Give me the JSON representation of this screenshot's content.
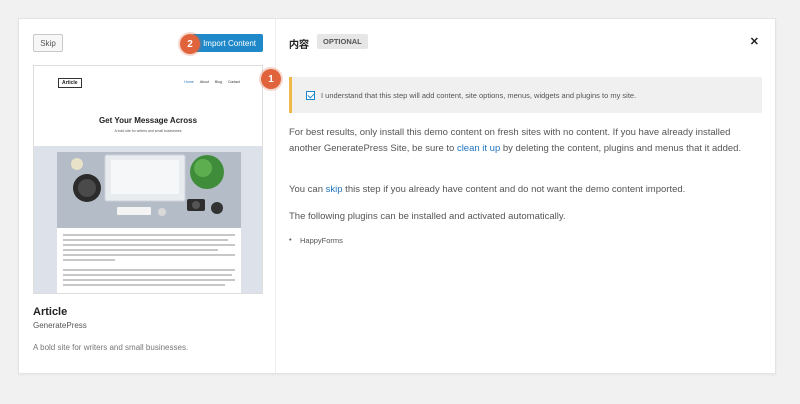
{
  "left": {
    "skip_label": "Skip",
    "import_label": "Import Content",
    "badge_two": "2",
    "preview": {
      "logo": "Article",
      "nav": [
        "Home",
        "About",
        "Blog",
        "Contact"
      ],
      "hero_title": "Get Your Message Across",
      "hero_sub": "A bold site for writers and small businesses"
    },
    "site_name": "Article",
    "site_author": "GeneratePress",
    "site_description": "A bold site for writers and small businesses."
  },
  "right": {
    "title": "内容",
    "optional_label": "OPTIONAL",
    "close_icon": "close-icon",
    "badge_one": "1",
    "notice_text": "I understand that this step will add content, site options, menus, widgets and plugins to my site.",
    "checkbox_checked": true,
    "para1_before": "For best results, only install this demo content on fresh sites with no content. If you have already installed another GeneratePress Site, be sure to ",
    "para1_link": "clean it up",
    "para1_after": " by deleting the content, plugins and menus that it added.",
    "para2_before": "You can ",
    "para2_link": "skip",
    "para2_after": " this step if you already have content and do not want the demo content imported.",
    "para3": "The following plugins can be installed and activated automatically.",
    "plugins": [
      "HappyForms"
    ]
  },
  "colors": {
    "accent": "#1e88c9",
    "badge": "#e0633c",
    "notice_border": "#f0b849"
  }
}
